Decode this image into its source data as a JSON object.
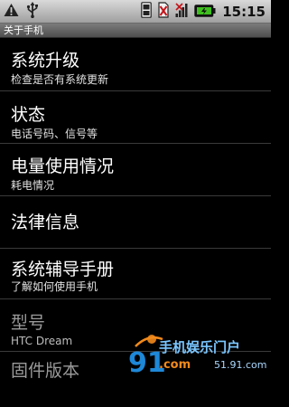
{
  "status_bar": {
    "time": "15:15",
    "icons": [
      "warning-icon",
      "usb-icon",
      "sync-icon",
      "no-sim-icon",
      "signal-icon",
      "battery-icon"
    ]
  },
  "title_bar": {
    "title": "关于手机"
  },
  "menu": {
    "items": [
      {
        "label": "系统升级",
        "sub": "检查是否有系统更新"
      },
      {
        "label": "状态",
        "sub": "电话号码、信号等"
      },
      {
        "label": "电量使用情况",
        "sub": "耗电情况"
      },
      {
        "label": "法律信息",
        "sub": ""
      },
      {
        "label": "系统辅导手册",
        "sub": "了解如何使用手机"
      },
      {
        "label": "型号",
        "sub": "HTC Dream"
      },
      {
        "label": "固件版本",
        "sub": ""
      }
    ]
  },
  "watermark": {
    "brand": "手机娱乐门户",
    "domain": "51.91.com",
    "logo": "91",
    "com": ".com"
  },
  "colors": {
    "status_bar_top": "#d9d9d9",
    "status_bar_bottom": "#9f9f9f",
    "battery_green": "#3fbf1f",
    "watermark_blue": "#1e88d8",
    "watermark_orange": "#f28a1c"
  }
}
